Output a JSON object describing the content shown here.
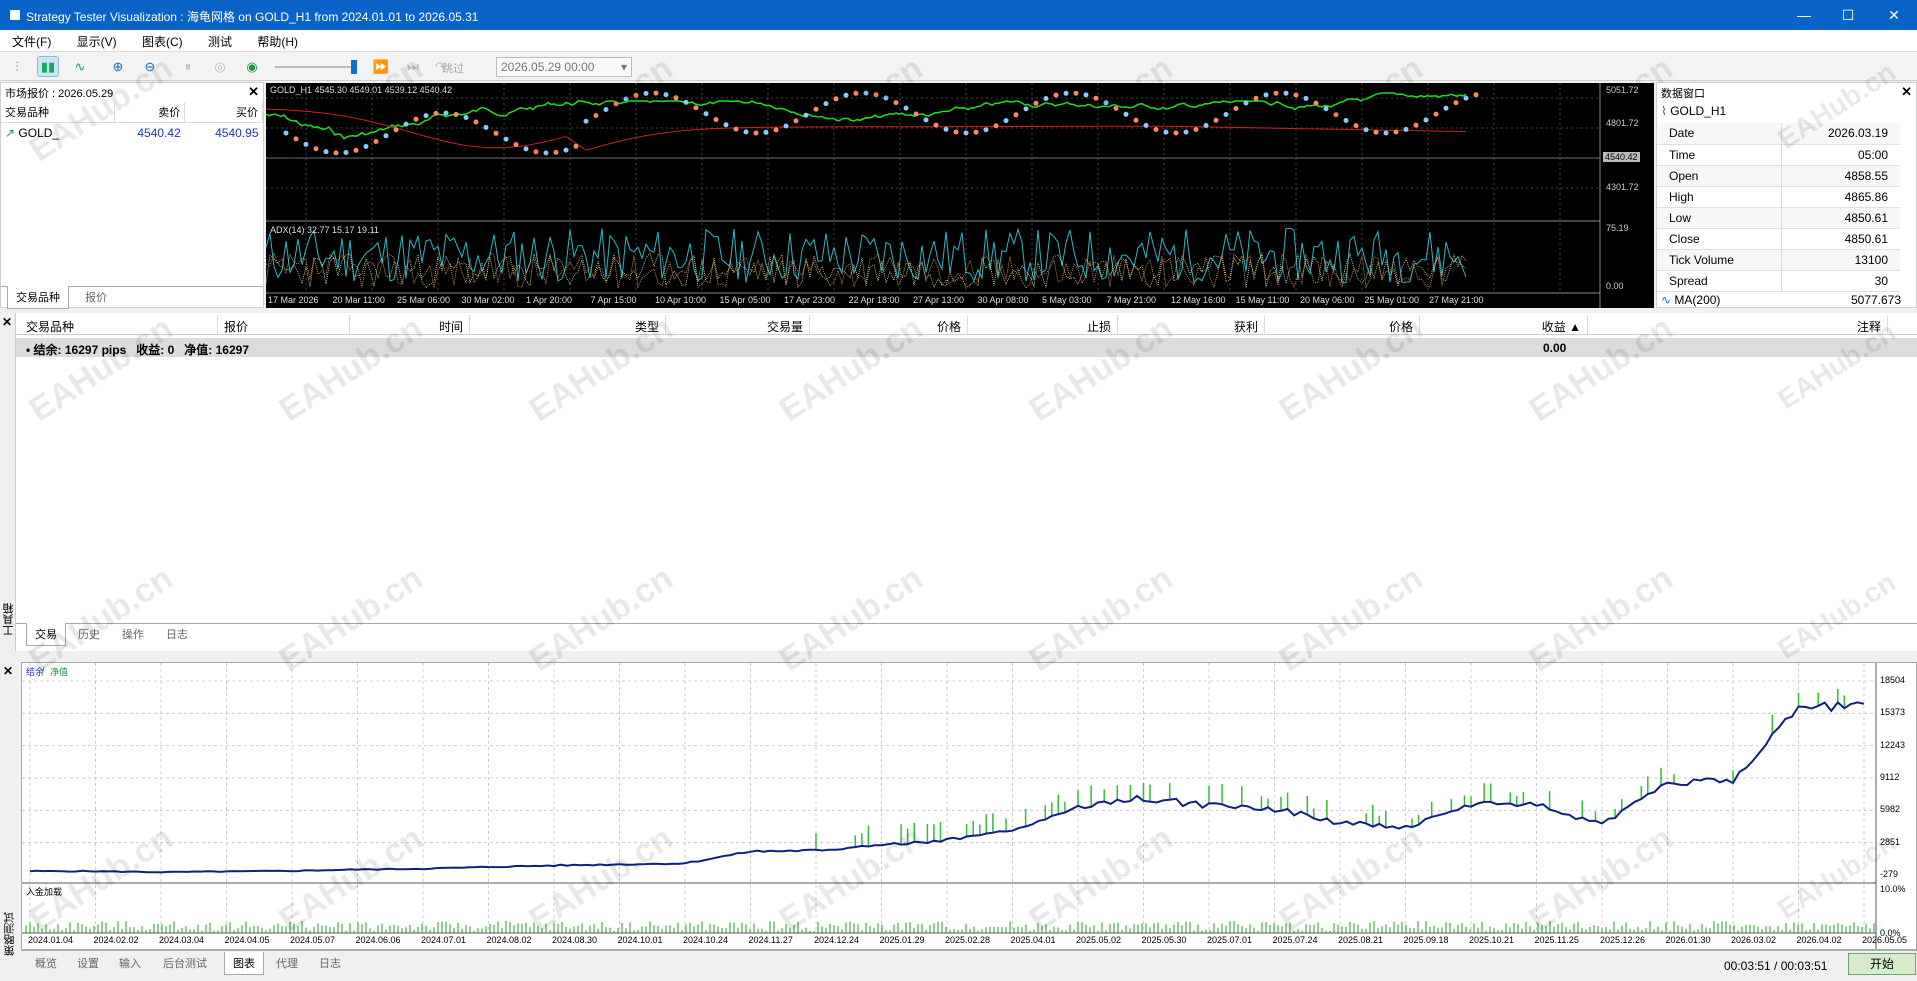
{
  "window": {
    "title": "Strategy Tester Visualization : 海龟网格 on GOLD_H1 from 2024.01.01 to 2026.05.31"
  },
  "menu": [
    "文件(F)",
    "显示(V)",
    "图表(C)",
    "测试",
    "帮助(H)"
  ],
  "toolbar": {
    "skip_label": "跳过",
    "date_value": "2026.05.29 00:00"
  },
  "market_watch": {
    "title": "市场报价 : 2026.05.29",
    "columns": [
      "交易品种",
      "卖价",
      "买价"
    ],
    "rows": [
      {
        "symbol": "GOLD_",
        "bid": "4540.42",
        "ask": "4540.95"
      }
    ],
    "tabs": [
      "交易品种",
      "报价"
    ]
  },
  "chart": {
    "title": "GOLD_H1   4545.30 4549.01 4539.12 4540.42",
    "price_axis": [
      "5051.72",
      "4801.72",
      "4540.42",
      "4301.72"
    ],
    "indicator_title": "ADX(14) 32.77 15.17 19.11",
    "indicator_axis": [
      "75.19",
      "0.00"
    ],
    "time_labels": [
      "17 Mar 2026",
      "20 Mar 11:00",
      "25 Mar 06:00",
      "30 Mar 02:00",
      "1 Apr 20:00",
      "7 Apr 15:00",
      "10 Apr 10:00",
      "15 Apr 05:00",
      "17 Apr 23:00",
      "22 Apr 18:00",
      "27 Apr 13:00",
      "30 Apr 08:00",
      "5 May 03:00",
      "7 May 21:00",
      "12 May 16:00",
      "15 May 11:00",
      "20 May 06:00",
      "25 May 01:00",
      "27 May 21:00"
    ]
  },
  "data_window": {
    "title": "数据窗口",
    "symbol": "GOLD_H1",
    "rows": [
      {
        "k": "Date",
        "v": "2026.03.19"
      },
      {
        "k": "Time",
        "v": "05:00"
      },
      {
        "k": "Open",
        "v": "4858.55"
      },
      {
        "k": "High",
        "v": "4865.86"
      },
      {
        "k": "Low",
        "v": "4850.61"
      },
      {
        "k": "Close",
        "v": "4850.61"
      },
      {
        "k": "Tick Volume",
        "v": "13100"
      },
      {
        "k": "Spread",
        "v": "30"
      }
    ],
    "ma_label": "MA(200)",
    "ma_value": "5077.673"
  },
  "toolbox": {
    "side_label": "工具箱",
    "columns": [
      "交易品种",
      "报价",
      "时间",
      "类型",
      "交易量",
      "价格",
      "止损",
      "获利",
      "价格",
      "收益",
      "注释"
    ],
    "summary": {
      "balance": "结余: 16297 pips",
      "profit": "收益: 0",
      "equity": "净值: 16297",
      "total": "0.00"
    },
    "tabs": [
      "交易",
      "历史",
      "操作",
      "日志"
    ]
  },
  "tester": {
    "side_label": "策略测试",
    "legend_balance": "结余",
    "legend_equity": "净值",
    "sub_label": "入金加载",
    "y_axis": [
      "18504",
      "15373",
      "12243",
      "9112",
      "5982",
      "2851",
      "-279"
    ],
    "sub_axis": [
      "10.0%",
      "0.0%"
    ],
    "x_axis": [
      "2024.01.04",
      "2024.02.02",
      "2024.03.04",
      "2024.04.05",
      "2024.05.07",
      "2024.06.06",
      "2024.07.01",
      "2024.08.02",
      "2024.08.30",
      "2024.10.01",
      "2024.10.24",
      "2024.11.27",
      "2024.12.24",
      "2025.01.29",
      "2025.02.28",
      "2025.04.01",
      "2025.05.02",
      "2025.05.30",
      "2025.07.01",
      "2025.07.24",
      "2025.08.21",
      "2025.09.18",
      "2025.10.21",
      "2025.11.25",
      "2025.12.26",
      "2026.01.30",
      "2026.03.02",
      "2026.04.02",
      "2026.05.05"
    ],
    "tabs": [
      "概览",
      "设置",
      "输入",
      "后台测试",
      "图表",
      "代理",
      "日志"
    ],
    "elapsed": "00:03:51 / 00:03:51",
    "start": "开始"
  },
  "watermark": "EAHub.cn",
  "chart_data": {
    "type": "line",
    "title": "",
    "x": [
      "2024.01.04",
      "2024.02.02",
      "2024.03.04",
      "2024.04.05",
      "2024.05.07",
      "2024.06.06",
      "2024.07.01",
      "2024.08.02",
      "2024.08.30",
      "2024.10.01",
      "2024.10.24",
      "2024.11.27",
      "2024.12.24",
      "2025.01.29",
      "2025.02.28",
      "2025.04.01",
      "2025.05.02",
      "2025.05.30",
      "2025.07.01",
      "2025.07.24",
      "2025.08.21",
      "2025.09.18",
      "2025.10.21",
      "2025.11.25",
      "2025.12.26",
      "2026.01.30",
      "2026.03.02",
      "2026.04.02",
      "2026.05.05"
    ],
    "series": [
      {
        "name": "结余",
        "values": [
          100,
          80,
          0,
          60,
          120,
          250,
          330,
          500,
          640,
          750,
          850,
          2000,
          2100,
          2600,
          3100,
          4000,
          6200,
          7200,
          6400,
          6100,
          4800,
          4300,
          6500,
          6600,
          4600,
          8600,
          9000,
          15800,
          16300
        ]
      }
    ],
    "ylim": [
      -279,
      18504
    ]
  }
}
